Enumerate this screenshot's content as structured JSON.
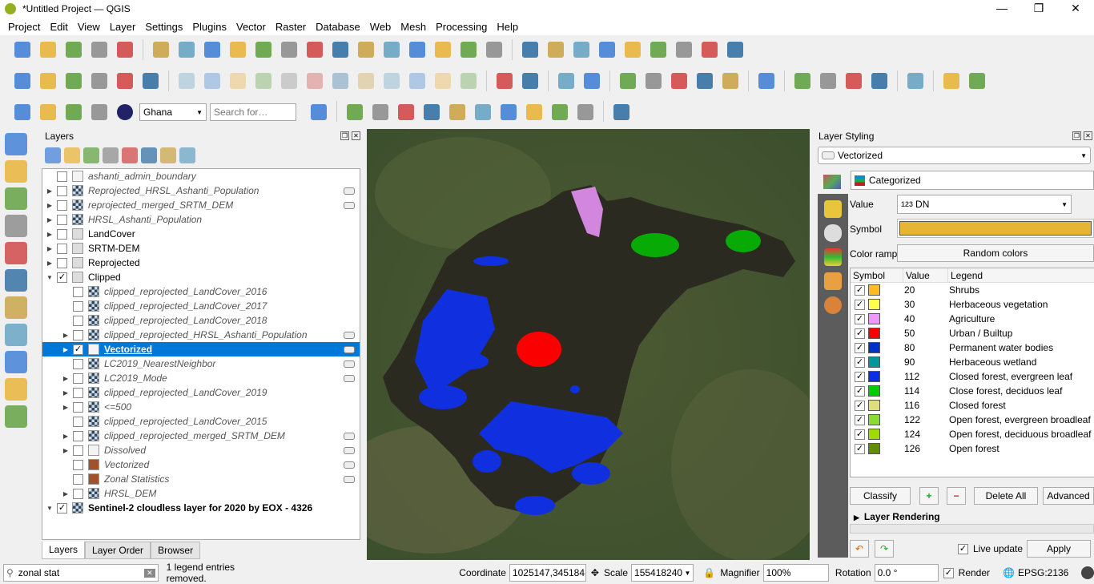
{
  "window": {
    "title": "*Untitled Project — QGIS",
    "minimize": "—",
    "maximize": "❐",
    "close": "✕"
  },
  "menu": [
    "Project",
    "Edit",
    "View",
    "Layer",
    "Settings",
    "Plugins",
    "Vector",
    "Raster",
    "Database",
    "Web",
    "Mesh",
    "Processing",
    "Help"
  ],
  "toolbar1": [
    "new-project-icon",
    "open-project-icon",
    "save-project-icon",
    "save-as-icon",
    "print-layout-icon",
    "|",
    "pan-icon",
    "pan-to-selection-icon",
    "zoom-in-icon",
    "zoom-out-icon",
    "zoom-full-icon",
    "zoom-to-selection-icon",
    "zoom-to-layer-icon",
    "zoom-native-icon",
    "zoom-last-icon",
    "zoom-next-icon",
    "new-bookmark-icon",
    "show-bookmarks-icon",
    "temporal-controller-icon",
    "refresh-icon",
    "|",
    "identify-icon",
    "attribute-table-icon",
    "statistics-icon",
    "processing-toolbox-icon",
    "sum-icon",
    "measure-icon",
    "map-tips-icon",
    "annotation-icon",
    "text-annotation-icon"
  ],
  "toolbar2": [
    "data-source-manager-icon",
    "new-layer-icon",
    "digitize-icon",
    "edit-pencil-icon",
    "save-edits-icon",
    "vertex-tool-icon",
    "|",
    "add-feature-icon",
    "edit-icon",
    "save-icon",
    "add-ring-icon",
    "move-feature-icon",
    "node-icon",
    "delete-icon",
    "cut-icon",
    "copy-icon",
    "paste-icon",
    "undo-icon",
    "redo-icon",
    "|",
    "label-icon",
    "diagram-icon",
    "|",
    "pin-label-icon",
    "show-label-icon",
    "|",
    "label-tool-1-icon",
    "label-tool-2-icon",
    "label-tool-3-icon",
    "label-tool-4-icon",
    "label-tool-5-icon",
    "|",
    "db-manager-icon",
    "|",
    "topology-checker-icon",
    "geocoder-icon",
    "georeferencer-icon",
    "spy-icon",
    "|",
    "help-icon",
    "|",
    "plugin-1-icon",
    "plugin-2-icon"
  ],
  "toolbar3": {
    "icons_left": [
      "select-features-icon",
      "deselect-icon",
      "select-by-attribute-icon",
      "select-location-icon"
    ],
    "locator_value": "Ghana",
    "search_placeholder": "Search for…",
    "icons_right": [
      "profile-tool-icon",
      "|",
      "osm-search-icon",
      "quick-map-services-icon",
      "python-console-icon",
      "qgis2web-icon",
      "open-folder-icon",
      "georef-icon",
      "layer-icon",
      "globe-icon",
      "map-icon",
      "info-icon",
      "|",
      "curve-icon"
    ]
  },
  "left_icons": [
    "add-vector-layer-icon",
    "add-raster-layer-icon",
    "add-mesh-layer-icon",
    "add-delimited-text-icon",
    "add-spatialite-icon",
    "add-virtual-layer-icon",
    "add-postgis-icon",
    "add-wms-icon",
    "add-wfs-icon",
    "add-wcs-icon",
    "add-gpx-icon"
  ],
  "layers_panel": {
    "title": "Layers",
    "tools": [
      "style-manager-icon",
      "add-group-icon",
      "manage-visibility-icon",
      "filter-legend-icon",
      "filter-expression-icon",
      "expand-all-icon",
      "collapse-all-icon",
      "remove-layer-icon"
    ],
    "items": [
      {
        "name": "ashanti_admin_boundary",
        "checked": false,
        "italic": true,
        "bold": false,
        "indent": 0,
        "expand": false,
        "icon": "polygon-layer-icon",
        "badge": false
      },
      {
        "name": "Reprojected_HRSL_Ashanti_Population",
        "checked": false,
        "italic": true,
        "bold": false,
        "indent": 0,
        "expand": true,
        "icon": "raster-layer-icon",
        "badge": true
      },
      {
        "name": "reprojected_merged_SRTM_DEM",
        "checked": false,
        "italic": true,
        "bold": false,
        "indent": 0,
        "expand": true,
        "icon": "raster-layer-icon",
        "badge": true
      },
      {
        "name": "HRSL_Ashanti_Population",
        "checked": false,
        "italic": true,
        "bold": false,
        "indent": 0,
        "expand": true,
        "icon": "raster-layer-icon",
        "badge": false
      },
      {
        "name": "LandCover",
        "checked": false,
        "italic": false,
        "bold": false,
        "indent": 0,
        "expand": true,
        "icon": "group-icon",
        "badge": false
      },
      {
        "name": "SRTM-DEM",
        "checked": false,
        "italic": false,
        "bold": false,
        "indent": 0,
        "expand": true,
        "icon": "group-icon",
        "badge": false
      },
      {
        "name": "Reprojected",
        "checked": false,
        "italic": false,
        "bold": false,
        "indent": 0,
        "expand": true,
        "icon": "group-icon",
        "badge": false
      },
      {
        "name": "Clipped",
        "checked": true,
        "italic": false,
        "bold": false,
        "indent": 0,
        "expand": "open",
        "icon": "group-icon",
        "badge": false
      },
      {
        "name": "clipped_reprojected_LandCover_2016",
        "checked": false,
        "italic": true,
        "bold": false,
        "indent": 1,
        "expand": false,
        "icon": "raster-layer-icon",
        "badge": false
      },
      {
        "name": "clipped_reprojected_LandCover_2017",
        "checked": false,
        "italic": true,
        "bold": false,
        "indent": 1,
        "expand": false,
        "icon": "raster-layer-icon",
        "badge": false
      },
      {
        "name": "clipped_reprojected_LandCover_2018",
        "checked": false,
        "italic": true,
        "bold": false,
        "indent": 1,
        "expand": false,
        "icon": "raster-layer-icon",
        "badge": false
      },
      {
        "name": "clipped_reprojected_HRSL_Ashanti_Population",
        "checked": false,
        "italic": true,
        "bold": false,
        "indent": 1,
        "expand": true,
        "icon": "raster-layer-icon",
        "badge": true
      },
      {
        "name": "Vectorized",
        "checked": true,
        "italic": false,
        "bold": true,
        "indent": 1,
        "expand": true,
        "icon": "polygon-layer-icon",
        "badge": true,
        "selected": true
      },
      {
        "name": "LC2019_NearestNeighbor",
        "checked": false,
        "italic": true,
        "bold": false,
        "indent": 1,
        "expand": false,
        "icon": "raster-layer-icon",
        "badge": true
      },
      {
        "name": "LC2019_Mode",
        "checked": false,
        "italic": true,
        "bold": false,
        "indent": 1,
        "expand": true,
        "icon": "raster-layer-icon",
        "badge": true
      },
      {
        "name": "clipped_reprojected_LandCover_2019",
        "checked": false,
        "italic": true,
        "bold": false,
        "indent": 1,
        "expand": true,
        "icon": "raster-layer-icon",
        "badge": false
      },
      {
        "name": "<=500",
        "checked": false,
        "italic": true,
        "bold": false,
        "indent": 1,
        "expand": true,
        "icon": "raster-layer-icon",
        "badge": false
      },
      {
        "name": "clipped_reprojected_LandCover_2015",
        "checked": false,
        "italic": true,
        "bold": false,
        "indent": 1,
        "expand": false,
        "icon": "raster-layer-icon",
        "badge": false
      },
      {
        "name": "clipped_reprojected_merged_SRTM_DEM",
        "checked": false,
        "italic": true,
        "bold": false,
        "indent": 1,
        "expand": true,
        "icon": "raster-layer-icon",
        "badge": true
      },
      {
        "name": "Dissolved",
        "checked": false,
        "italic": true,
        "bold": false,
        "indent": 1,
        "expand": true,
        "icon": "polygon-layer-icon",
        "badge": true
      },
      {
        "name": "Vectorized",
        "checked": false,
        "italic": true,
        "bold": false,
        "indent": 1,
        "expand": false,
        "icon": "fill-brown-icon",
        "badge": true
      },
      {
        "name": "Zonal Statistics",
        "checked": false,
        "italic": true,
        "bold": false,
        "indent": 1,
        "expand": false,
        "icon": "fill-brown-icon",
        "badge": true
      },
      {
        "name": "HRSL_DEM",
        "checked": false,
        "italic": true,
        "bold": false,
        "indent": 1,
        "expand": true,
        "icon": "raster-layer-icon",
        "badge": false
      },
      {
        "name": "Sentinel-2 cloudless layer for 2020 by EOX - 4326",
        "checked": true,
        "italic": false,
        "bold": true,
        "indent": 0,
        "expand": "open",
        "icon": "raster-layer-icon",
        "badge": false
      }
    ],
    "tabs": [
      "Layers",
      "Layer Order",
      "Browser"
    ]
  },
  "styling": {
    "title": "Layer Styling",
    "layer": "Vectorized",
    "renderer": "Categorized",
    "value_label": "Value",
    "value_prefix": "123",
    "value": "DN",
    "symbol_label": "Symbol",
    "symbol_color": "#e5b533",
    "ramp_label": "Color ramp",
    "ramp": "Random colors",
    "headers": [
      "Symbol",
      "Value",
      "Legend"
    ],
    "categories": [
      {
        "value": "20",
        "legend": "Shrubs",
        "color": "#ffbb22"
      },
      {
        "value": "30",
        "legend": "Herbaceous vegetation",
        "color": "#ffff4c"
      },
      {
        "value": "40",
        "legend": "Agriculture",
        "color": "#f096ff"
      },
      {
        "value": "50",
        "legend": "Urban / Builtup",
        "color": "#fa0000"
      },
      {
        "value": "80",
        "legend": "Permanent water bodies",
        "color": "#0032c8"
      },
      {
        "value": "90",
        "legend": "Herbaceous wetland",
        "color": "#0096a0"
      },
      {
        "value": "112",
        "legend": "Closed forest, evergreen leaf",
        "color": "#0a2ee8"
      },
      {
        "value": "114",
        "legend": "Close forest, deciduos leaf",
        "color": "#00cc00"
      },
      {
        "value": "116",
        "legend": "Closed forest",
        "color": "#dde07a"
      },
      {
        "value": "122",
        "legend": "Open forest, evergreen broadleaf",
        "color": "#88dd33"
      },
      {
        "value": "124",
        "legend": "Open forest, deciduous broadleaf",
        "color": "#a0dc00"
      },
      {
        "value": "126",
        "legend": "Open forest",
        "color": "#648c00"
      }
    ],
    "classify": "Classify",
    "delete_all": "Delete All",
    "advanced": "Advanced",
    "layer_rendering": "Layer Rendering",
    "live_update": "Live update",
    "apply": "Apply"
  },
  "statusbar": {
    "search_value": "zonal stat",
    "message": "1 legend entries removed.",
    "coordinate_label": "Coordinate",
    "coordinate": "1025147,345184",
    "scale_label": "Scale",
    "scale": "155418240",
    "magnifier_label": "Magnifier",
    "magnifier": "100%",
    "rotation_label": "Rotation",
    "rotation": "0.0 °",
    "render_label": "Render",
    "crs": "EPSG:2136"
  }
}
